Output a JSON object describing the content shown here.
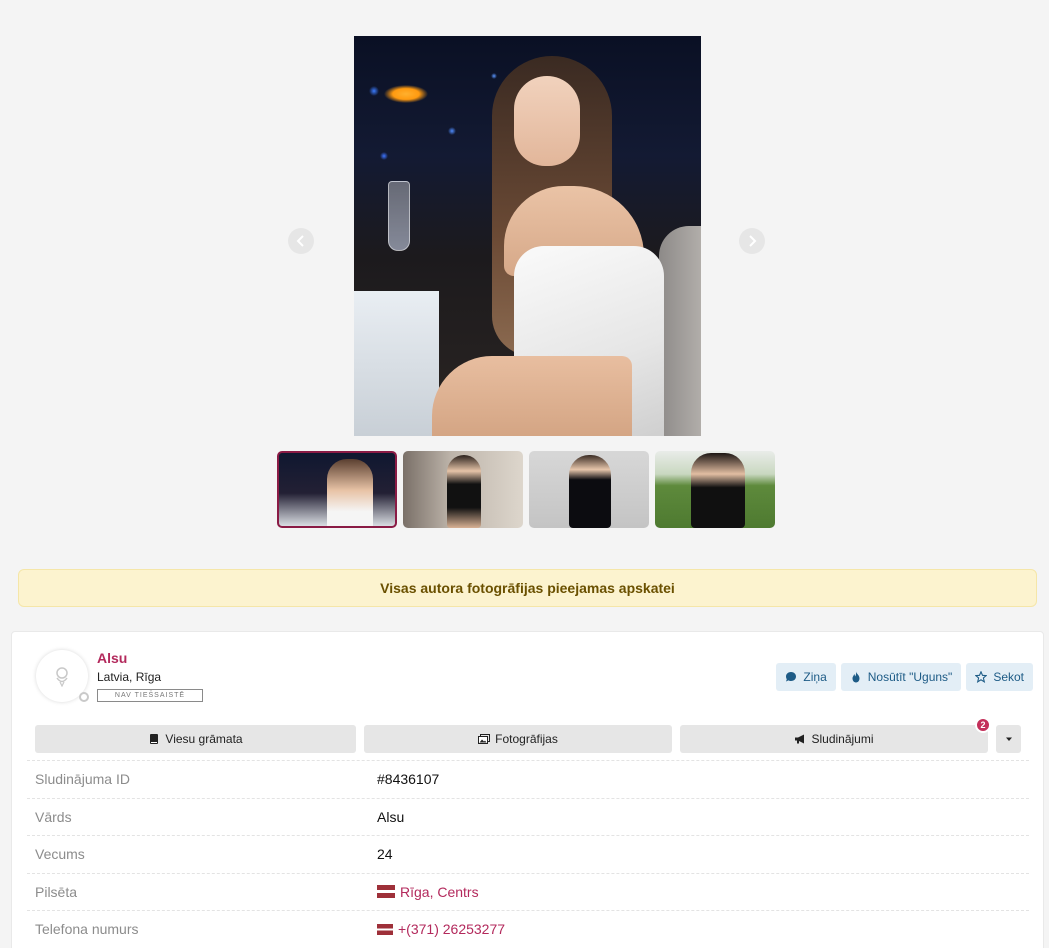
{
  "notice": {
    "text": "Visas autora fotogrāfijas pieejamas apskatei"
  },
  "profile": {
    "name": "Alsu",
    "location": "Latvia, Rīga",
    "status": "NAV TIEŠSAISTĒ"
  },
  "actions": {
    "message": "Ziņa",
    "send_fire": "Nosūtīt \"Uguns\"",
    "follow": "Sekot"
  },
  "tabs": {
    "guestbook": "Viesu grāmata",
    "photos": "Fotogrāfijas",
    "ads": "Sludinājumi",
    "ads_count": "2"
  },
  "info": [
    {
      "label": "Sludinājuma ID",
      "value": "#8436107"
    },
    {
      "label": "Vārds",
      "value": "Alsu"
    },
    {
      "label": "Vecums",
      "value": "24"
    },
    {
      "label": "Pilsēta",
      "value": "Rīga, Centrs"
    },
    {
      "label": "Telefona numurs",
      "value": "+(371) 26253277"
    }
  ],
  "gallery": {
    "photo_count": 4,
    "active_index": 0
  },
  "colors": {
    "accent": "#b3295c",
    "notice_bg": "#fcf3cf",
    "action_bg": "#e3eef6",
    "badge": "#c3305a"
  }
}
